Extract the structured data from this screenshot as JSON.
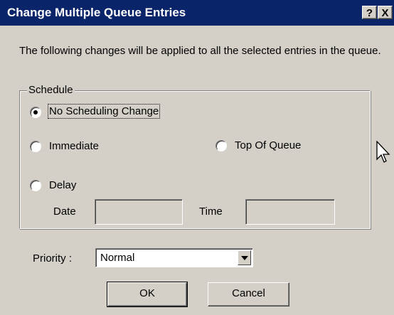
{
  "window": {
    "title": "Change Multiple Queue Entries",
    "help_label": "?",
    "close_label": "X"
  },
  "message": "The following changes will be applied to all the selected entries in the queue.",
  "schedule": {
    "group_label": "Schedule",
    "options": {
      "no_change": {
        "label": "No Scheduling Change",
        "selected": true
      },
      "immediate": {
        "label": "Immediate",
        "selected": false
      },
      "top_of_queue": {
        "label": "Top Of Queue",
        "selected": false
      },
      "delay": {
        "label": "Delay",
        "selected": false
      }
    },
    "date_label": "Date",
    "time_label": "Time",
    "date_value": "",
    "time_value": ""
  },
  "priority": {
    "label": "Priority :",
    "selected": "Normal"
  },
  "buttons": {
    "ok": "OK",
    "cancel": "Cancel"
  }
}
